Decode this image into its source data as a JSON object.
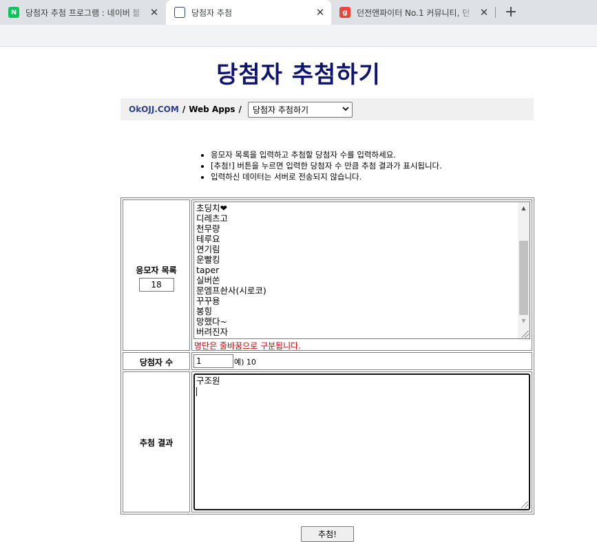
{
  "browser": {
    "tabs": [
      {
        "title": "당첨자 추첨 프로그램 : 네이버 블",
        "icon": "naver-favicon",
        "close": "✕"
      },
      {
        "title": "당첨자 추첨",
        "icon": "okojj-favicon",
        "close": "✕"
      },
      {
        "title": "던전앤파이터 No.1 커뮤니티, 던",
        "icon": "g-favicon",
        "close": "✕"
      }
    ],
    "new_tab": "+"
  },
  "page": {
    "title": "당첨자 추첨하기"
  },
  "nav": {
    "home": "OkOJJ.COM",
    "separator": "/",
    "section": "Web Apps",
    "select_value": "당첨자 추첨하기"
  },
  "notes": [
    "응모자 목록을 입력하고 추첨할 당첨자 수를 입력하세요.",
    "[추첨!] 버튼을 누르면 입력한 당첨자 수 만큼 추첨 결과가 표시됩니다.",
    "입력하신 데이터는 서버로 전송되지 않습니다."
  ],
  "form": {
    "entrants_label": "응모자 목록",
    "entrants_count": "18",
    "entrants": [
      "초딩치❤",
      "디레츠고",
      "천무량",
      "테루요",
      "연기림",
      "운빨킹",
      "taper",
      "실버쏜",
      "문엠프솬사(시로코)",
      "꾸꾸용",
      "봉힝",
      "망했다~",
      "버려진자"
    ],
    "entrants_hint": "명단은 줄바꿈으로 구분됩니다.",
    "winners_label": "당첨자 수",
    "winners_value": "1",
    "winners_example": "예) 10",
    "result_label": "추첨 결과",
    "result_value": "구조원"
  },
  "draw_button": "추첨!"
}
